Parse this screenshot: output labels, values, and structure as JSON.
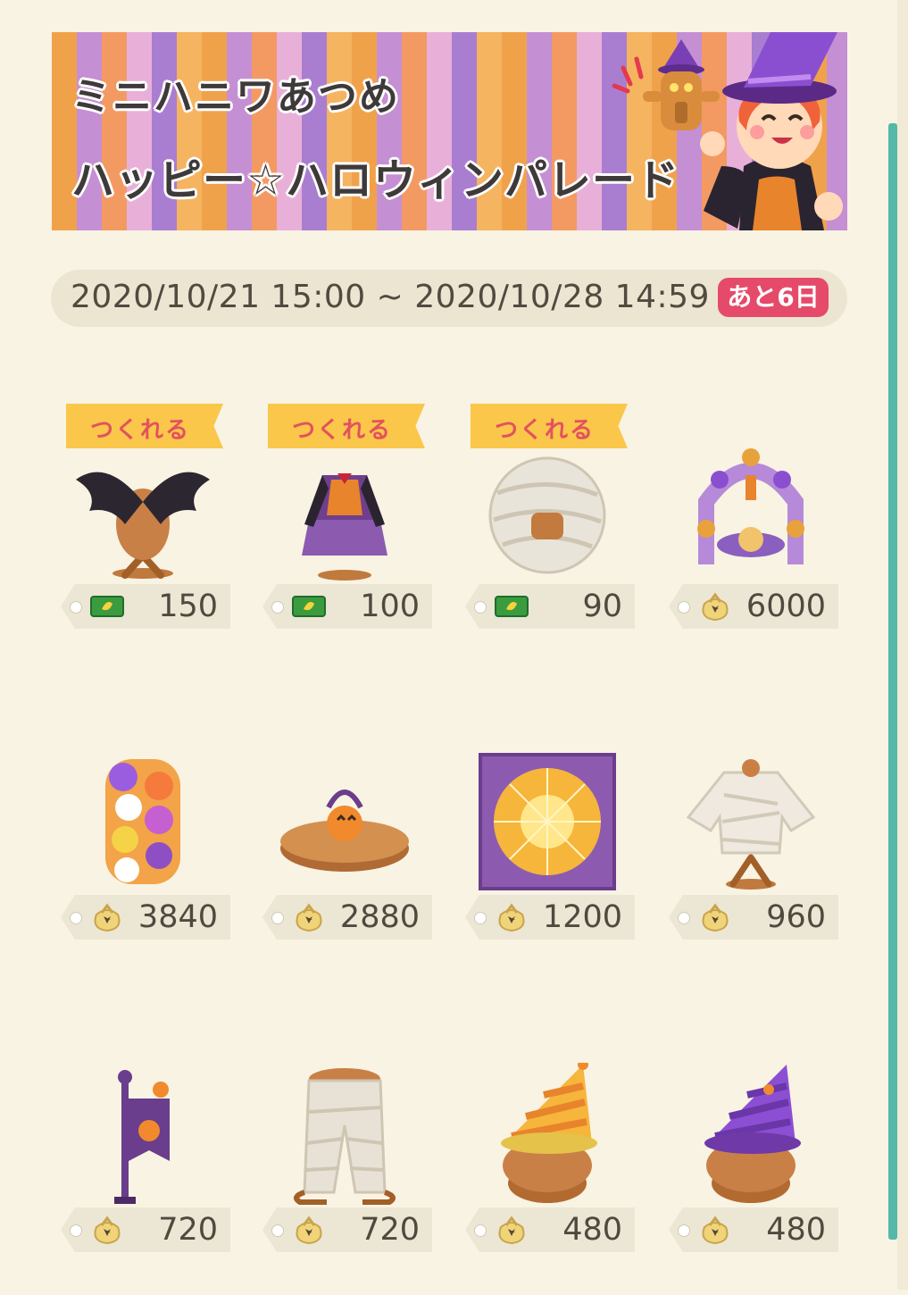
{
  "banner": {
    "title_line1": "ミニハニワあつめ",
    "title_line2": "ハッピー☆ハロウィンパレード"
  },
  "period": {
    "range": "2020/10/21 15:00 ~ 2020/10/28 14:59",
    "remaining": "あと6日"
  },
  "craft_label": "つくれる",
  "colors": {
    "background": "#f8f3e3",
    "ribbon": "#fac74a",
    "ribbon_text": "#e4515e",
    "remaining_badge": "#e64a6a",
    "scrollbar": "#55b8a8"
  },
  "items": [
    {
      "art": "crow-wings-icon",
      "craftable": true,
      "currency": "ticket-icon",
      "price": "150"
    },
    {
      "art": "witch-dress-icon",
      "craftable": true,
      "currency": "ticket-icon",
      "price": "100"
    },
    {
      "art": "mummy-mask-icon",
      "craftable": true,
      "currency": "ticket-icon",
      "price": "90"
    },
    {
      "art": "halloween-balloon-arch-icon",
      "craftable": false,
      "currency": "bells-bag-icon",
      "price": "6000"
    },
    {
      "art": "balloon-pillar-icon",
      "craftable": false,
      "currency": "bells-bag-icon",
      "price": "3840"
    },
    {
      "art": "pumpkin-pedestal-icon",
      "craftable": false,
      "currency": "bells-bag-icon",
      "price": "2880"
    },
    {
      "art": "spiderweb-floor-icon",
      "craftable": false,
      "currency": "bells-bag-icon",
      "price": "1200"
    },
    {
      "art": "mummy-shirt-icon",
      "craftable": false,
      "currency": "bells-bag-icon",
      "price": "960"
    },
    {
      "art": "halloween-flag-lamp-icon",
      "craftable": false,
      "currency": "bells-bag-icon",
      "price": "720"
    },
    {
      "art": "mummy-pants-icon",
      "craftable": false,
      "currency": "bells-bag-icon",
      "price": "720"
    },
    {
      "art": "orange-party-hat-icon",
      "craftable": false,
      "currency": "bells-bag-icon",
      "price": "480"
    },
    {
      "art": "purple-party-hat-icon",
      "craftable": false,
      "currency": "bells-bag-icon",
      "price": "480"
    }
  ]
}
